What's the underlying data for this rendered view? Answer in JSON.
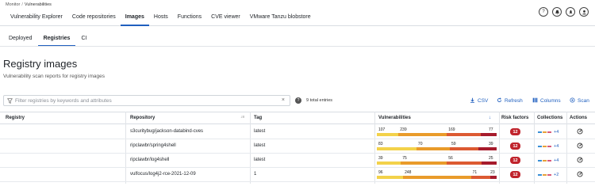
{
  "breadcrumb": {
    "parent": "Monitor",
    "separator": "/",
    "current": "Vulnerabilities"
  },
  "nav": {
    "tabs": [
      "Vulnerability Explorer",
      "Code repositories",
      "Images",
      "Hosts",
      "Functions",
      "CVE viewer",
      "VMware Tanzu blobstore"
    ],
    "active": "Images"
  },
  "top_icons": [
    "help-icon",
    "notifications-icon",
    "rocket-icon",
    "user-icon"
  ],
  "subtabs": {
    "items": [
      "Deployed",
      "Registries",
      "CI"
    ],
    "active": "Registries"
  },
  "page": {
    "title": "Registry images",
    "subtitle": "Vulnerability scan reports for registry images"
  },
  "filter": {
    "placeholder": "Filter registries by keywords and attributes",
    "value": "",
    "clear": "×"
  },
  "help_glyph": "?",
  "entries": "9 total entries",
  "actions": {
    "csv": "CSV",
    "refresh": "Refresh",
    "columns": "Columns",
    "scan": "Scan"
  },
  "columns": {
    "registry": "Registry",
    "repository": "Repository",
    "tag": "Tag",
    "vulnerabilities": "Vulnerabilities",
    "risk": "Risk factors",
    "collections": "Collections",
    "actions": "Actions"
  },
  "colors": {
    "critical": "#a61b2c",
    "high": "#dc5a32",
    "medium": "#e99b2a",
    "low": "#f3d24a",
    "accent": "#1f5fbf",
    "risk": "#c0232c"
  },
  "rows": [
    {
      "registry": "",
      "repository": "s3curitybug/jackson-databind-cves",
      "tag": "latest",
      "vuln": {
        "low": 107,
        "medium": 239,
        "high": 169,
        "critical": 77
      },
      "risk": "12",
      "collections_more": "+4"
    },
    {
      "registry": "",
      "repository": "ripclawbr/spring4shell",
      "tag": "latest",
      "vuln": {
        "low": 83,
        "medium": 70,
        "high": 59,
        "critical": 39
      },
      "risk": "12",
      "collections_more": "+4"
    },
    {
      "registry": "",
      "repository": "ripclawbr/log4shell",
      "tag": "latest",
      "vuln": {
        "low": 39,
        "medium": 75,
        "high": 56,
        "critical": 25
      },
      "risk": "12",
      "collections_more": "+4"
    },
    {
      "registry": "",
      "repository": "vulfocus/log4j2-rce-2021-12-09",
      "tag": "1",
      "vuln": {
        "low": 96,
        "medium": 248,
        "high": 71,
        "critical": 23
      },
      "risk": "12",
      "collections_more": "+2"
    }
  ]
}
